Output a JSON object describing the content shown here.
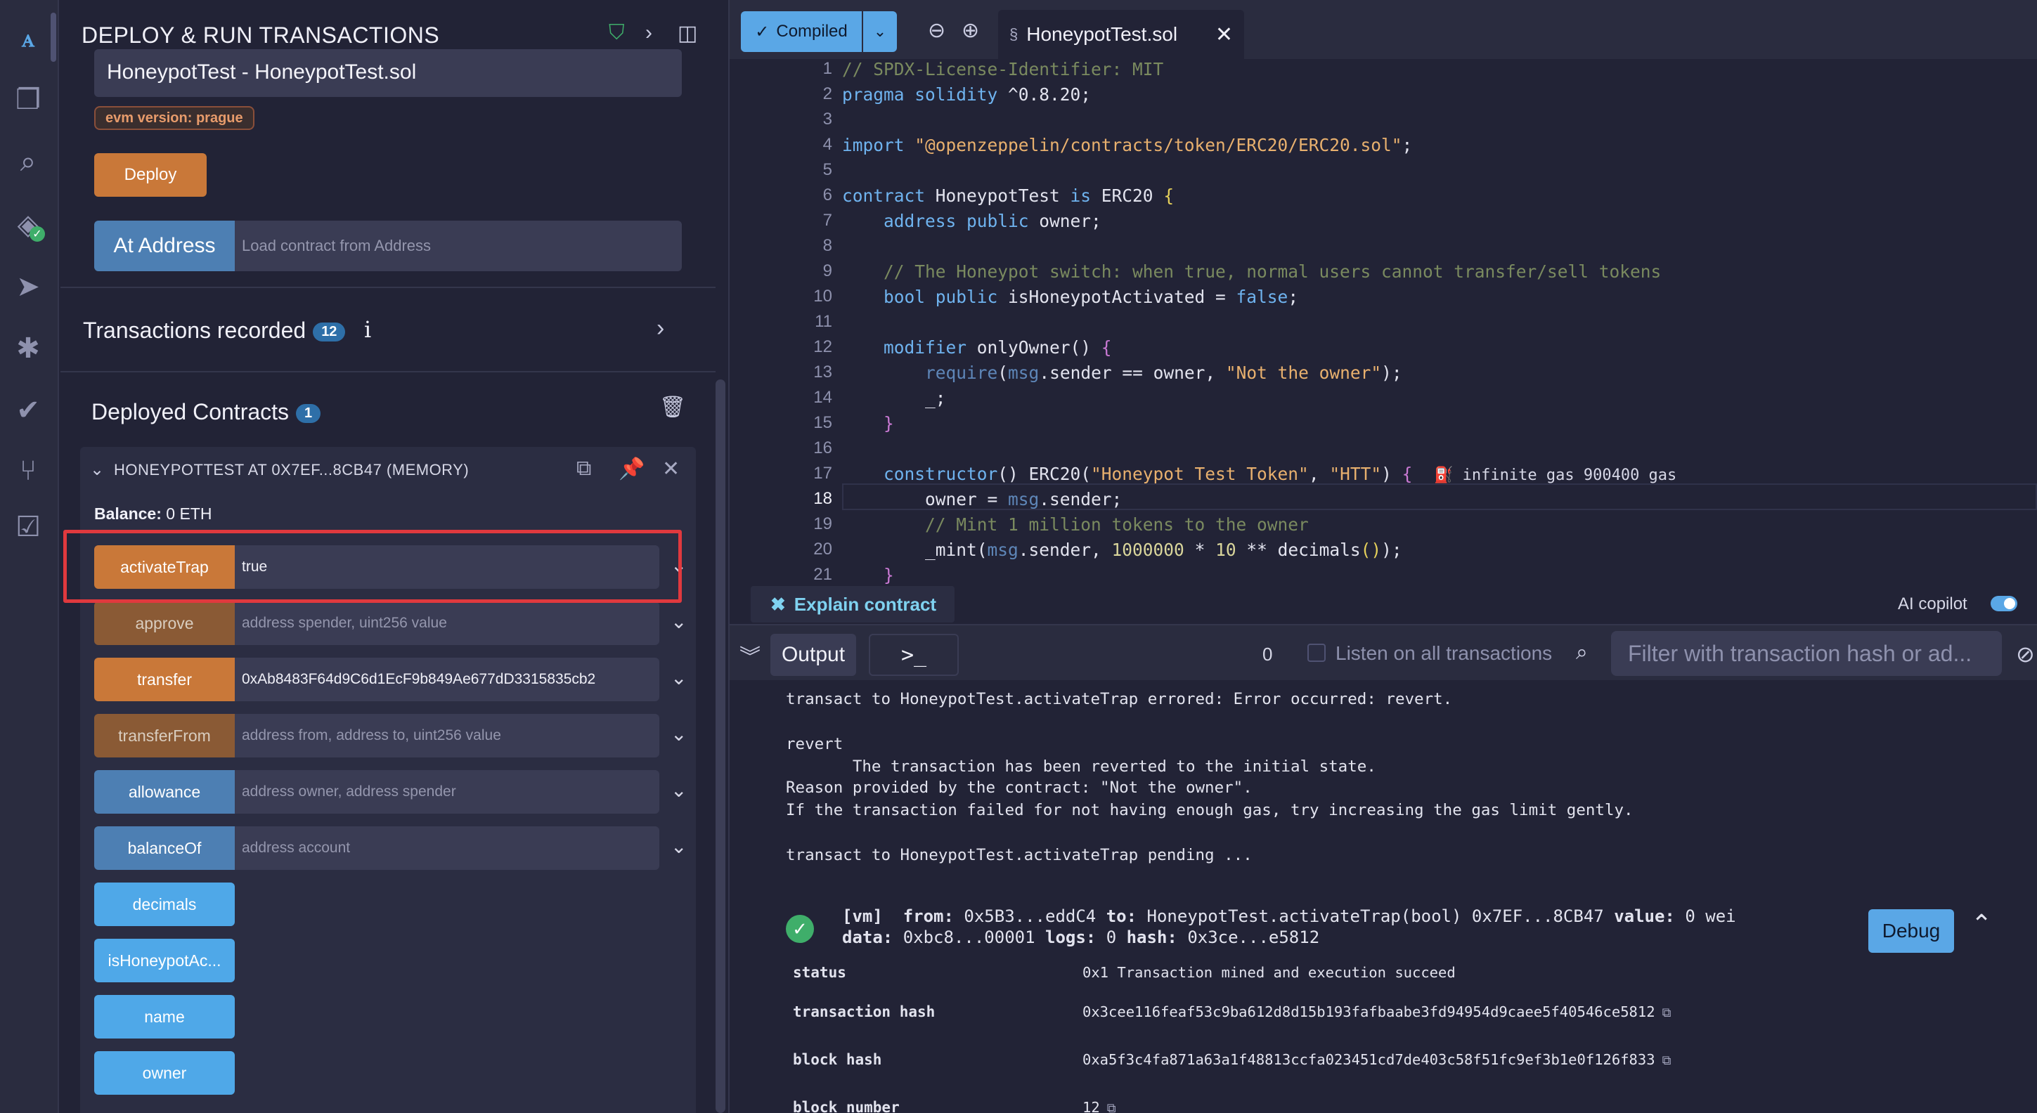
{
  "rail": {
    "items": [
      "remix-logo-icon",
      "file-explorer-icon",
      "search-icon",
      "solidity-compiler-icon",
      "deploy-run-icon",
      "debugger-icon",
      "unit-testing-icon",
      "git-icon",
      "verification-icon"
    ]
  },
  "panel": {
    "title": "DEPLOY & RUN TRANSACTIONS",
    "contract": "HoneypotTest - HoneypotTest.sol",
    "evm_badge": "evm version: prague",
    "deploy_label": "Deploy",
    "at_address_label": "At Address",
    "at_address_placeholder": "Load contract from Address",
    "transactions_recorded": "Transactions recorded",
    "transactions_count": "12",
    "info_glyph": "i",
    "deployed_title": "Deployed Contracts",
    "deployed_count": "1",
    "instance_title": "HONEYPOTTEST AT 0X7EF...8CB47 (MEMORY)",
    "balance_label": "Balance:",
    "balance_value": "0 ETH",
    "functions": [
      {
        "name": "activateTrap",
        "value": "true",
        "placeholder": ""
      },
      {
        "name": "approve",
        "value": "",
        "placeholder": "address spender, uint256 value"
      },
      {
        "name": "transfer",
        "value": "0xAb8483F64d9C6d1EcF9b849Ae677dD3315835cb2",
        "placeholder": ""
      },
      {
        "name": "transferFrom",
        "value": "",
        "placeholder": "address from, address to, uint256 value"
      },
      {
        "name": "allowance",
        "value": "",
        "placeholder": "address owner, address spender"
      },
      {
        "name": "balanceOf",
        "value": "",
        "placeholder": "address account"
      },
      {
        "name": "decimals"
      },
      {
        "name": "isHoneypotAc..."
      },
      {
        "name": "name"
      },
      {
        "name": "owner"
      }
    ]
  },
  "topbar": {
    "compiled_label": "Compiled",
    "file_tab": "HoneypotTest.sol"
  },
  "editor": {
    "current_line": "18",
    "gas_hint": "infinite gas 900400 gas",
    "line_numbers": [
      "1",
      "2",
      "3",
      "4",
      "5",
      "6",
      "7",
      "8",
      "9",
      "10",
      "11",
      "12",
      "13",
      "14",
      "15",
      "16",
      "17",
      "18",
      "19",
      "20",
      "21"
    ]
  },
  "explain": {
    "label": "Explain contract",
    "copilot_label": "AI copilot"
  },
  "terminal": {
    "output_tab": "Output",
    "shell_tab": ">_",
    "pending_count": "0",
    "listen_label": "Listen on all transactions",
    "filter_placeholder": "Filter with transaction hash or ad...",
    "log_lines": [
      "transact to HoneypotTest.activateTrap errored: Error occurred: revert.",
      "",
      "revert",
      "       The transaction has been reverted to the initial state.",
      "Reason provided by the contract: \"Not the owner\".",
      "If the transaction failed for not having enough gas, try increasing the gas limit gently.",
      "",
      "transact to HoneypotTest.activateTrap pending ..."
    ],
    "vm": {
      "tag": "[vm]",
      "from_label": "from:",
      "from": "0x5B3...eddC4",
      "to_label": "to:",
      "to": "HoneypotTest.activateTrap(bool) 0x7EF...8CB47",
      "value_label": "value:",
      "value": "0 wei",
      "data_label": "data:",
      "data": "0xbc8...00001",
      "logs_label": "logs:",
      "logs": "0",
      "hash_label": "hash:",
      "hash": "0x3ce...e5812"
    },
    "debug_label": "Debug",
    "details": [
      {
        "key": "status",
        "value": "0x1 Transaction mined and execution succeed"
      },
      {
        "key": "transaction hash",
        "value": "0x3cee116feaf53c9ba612d8d15b193fafbaabe3fd94954d9caee5f40546ce5812"
      },
      {
        "key": "block hash",
        "value": "0xa5f3c4fa871a63a1f48813ccfa023451cd7de403c58f51fc9ef3b1e0f126f833"
      },
      {
        "key": "block number",
        "value": "12"
      }
    ]
  }
}
